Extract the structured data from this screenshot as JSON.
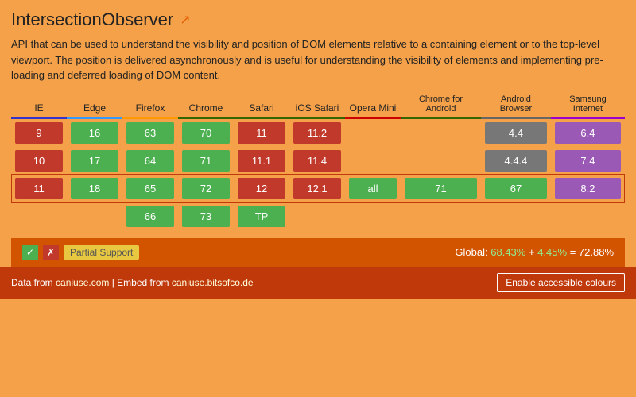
{
  "title": "IntersectionObserver",
  "external_link_label": "↗",
  "description": "API that can be used to understand the visibility and position of DOM elements relative to a containing element or to the top-level viewport. The position is delivered asynchronously and is useful for understanding the visibility of elements and implementing pre-loading and deferred loading of DOM content.",
  "browsers": [
    {
      "id": "ie",
      "label": "IE",
      "border_color": "#3333cc"
    },
    {
      "id": "edge",
      "label": "Edge",
      "border_color": "#3399ff"
    },
    {
      "id": "firefox",
      "label": "Firefox",
      "border_color": "#ff9900"
    },
    {
      "id": "chrome",
      "label": "Chrome",
      "border_color": "#336600"
    },
    {
      "id": "safari",
      "label": "Safari",
      "border_color": "#336600"
    },
    {
      "id": "ios_safari",
      "label": "iOS Safari",
      "border_color": "#336600"
    },
    {
      "id": "opera_mini",
      "label": "Opera Mini",
      "border_color": "#cc0000"
    },
    {
      "id": "chrome_android",
      "label": "Chrome for Android",
      "border_color": "#336600"
    },
    {
      "id": "android_browser",
      "label": "Android Browser",
      "border_color": "#666666"
    },
    {
      "id": "samsung",
      "label": "Samsung Internet",
      "border_color": "#9900cc"
    }
  ],
  "rows": [
    {
      "cells": [
        {
          "type": "red",
          "value": "9"
        },
        {
          "type": "green",
          "value": "16"
        },
        {
          "type": "green",
          "value": "63"
        },
        {
          "type": "green",
          "value": "70"
        },
        {
          "type": "red",
          "value": "11"
        },
        {
          "type": "red",
          "value": "11.2"
        },
        {
          "type": "empty",
          "value": ""
        },
        {
          "type": "empty",
          "value": ""
        },
        {
          "type": "gray",
          "value": "4.4"
        },
        {
          "type": "samsung",
          "value": "6.4"
        }
      ]
    },
    {
      "cells": [
        {
          "type": "red",
          "value": "10"
        },
        {
          "type": "green",
          "value": "17"
        },
        {
          "type": "green",
          "value": "64"
        },
        {
          "type": "green",
          "value": "71"
        },
        {
          "type": "red",
          "value": "11.1"
        },
        {
          "type": "red",
          "value": "11.4"
        },
        {
          "type": "empty",
          "value": ""
        },
        {
          "type": "empty",
          "value": ""
        },
        {
          "type": "gray",
          "value": "4.4.4"
        },
        {
          "type": "samsung",
          "value": "7.4"
        }
      ]
    },
    {
      "highlighted": true,
      "cells": [
        {
          "type": "red",
          "value": "11"
        },
        {
          "type": "green",
          "value": "18"
        },
        {
          "type": "green",
          "value": "65"
        },
        {
          "type": "green",
          "value": "72"
        },
        {
          "type": "red",
          "value": "12"
        },
        {
          "type": "red",
          "value": "12.1"
        },
        {
          "type": "green",
          "value": "all"
        },
        {
          "type": "green",
          "value": "71"
        },
        {
          "type": "green",
          "value": "67"
        },
        {
          "type": "samsung",
          "value": "8.2"
        }
      ]
    },
    {
      "cells": [
        {
          "type": "empty",
          "value": ""
        },
        {
          "type": "empty",
          "value": ""
        },
        {
          "type": "green",
          "value": "66"
        },
        {
          "type": "green",
          "value": "73"
        },
        {
          "type": "green-tp",
          "value": "TP"
        },
        {
          "type": "empty",
          "value": ""
        },
        {
          "type": "empty",
          "value": ""
        },
        {
          "type": "empty",
          "value": ""
        },
        {
          "type": "empty",
          "value": ""
        },
        {
          "type": "empty",
          "value": ""
        }
      ]
    }
  ],
  "legend": {
    "check_label": "✓",
    "cross_label": "✗",
    "partial_label": "Partial Support"
  },
  "global_stats": {
    "prefix": "Global:",
    "pct1": "68.43%",
    "plus": "+",
    "pct2": "4.45%",
    "equals": "=",
    "total": "72.88%"
  },
  "footer": {
    "text": "Data from ",
    "caniuse_link": "caniuse.com",
    "embed_text": " | Embed from ",
    "bitsofco_link": "caniuse.bitsofco.de",
    "button_label": "Enable accessible colours"
  }
}
